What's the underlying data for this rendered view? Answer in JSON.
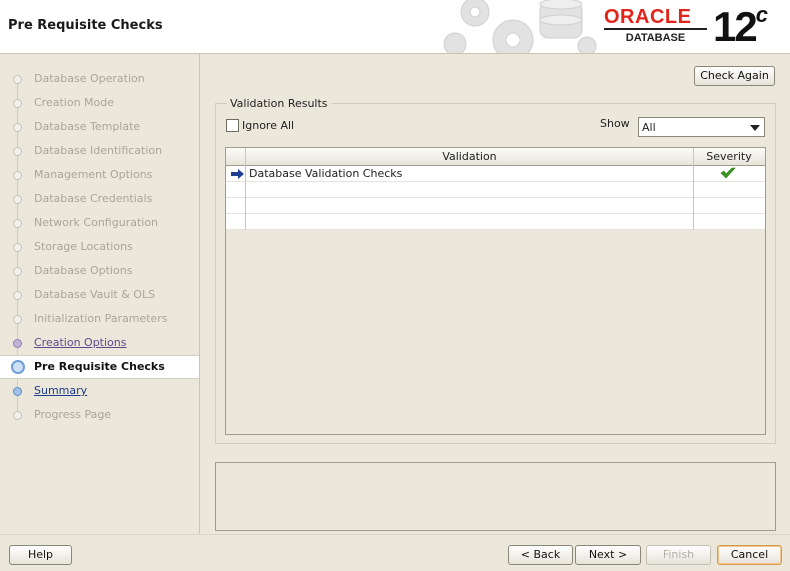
{
  "window": {
    "title": "Pre Requisite Checks"
  },
  "brand": {
    "oracle": "ORACLE",
    "database": "DATABASE",
    "version": "12",
    "version_suffix": "c"
  },
  "sidebar": {
    "steps": [
      {
        "label": "Database Operation",
        "state": "disabled"
      },
      {
        "label": "Creation Mode",
        "state": "disabled"
      },
      {
        "label": "Database Template",
        "state": "disabled"
      },
      {
        "label": "Database Identification",
        "state": "disabled"
      },
      {
        "label": "Management Options",
        "state": "disabled"
      },
      {
        "label": "Database Credentials",
        "state": "disabled"
      },
      {
        "label": "Network Configuration",
        "state": "disabled"
      },
      {
        "label": "Storage Locations",
        "state": "disabled"
      },
      {
        "label": "Database Options",
        "state": "disabled"
      },
      {
        "label": "Database Vault & OLS",
        "state": "disabled"
      },
      {
        "label": "Initialization Parameters",
        "state": "disabled"
      },
      {
        "label": "Creation Options",
        "state": "done"
      },
      {
        "label": "Pre Requisite Checks",
        "state": "current"
      },
      {
        "label": "Summary",
        "state": "link"
      },
      {
        "label": "Progress Page",
        "state": "disabled"
      }
    ]
  },
  "main": {
    "check_again_label": "Check Again",
    "group_title": "Validation Results",
    "ignore_all_label": "Ignore All",
    "ignore_all_checked": false,
    "show_label": "Show",
    "show_value": "All",
    "table": {
      "columns": [
        "Validation",
        "Severity"
      ],
      "rows": [
        {
          "validation": "Database Validation Checks",
          "severity_icon": "check-icon",
          "status": "passed"
        }
      ]
    }
  },
  "footer": {
    "help": "Help",
    "back": "< Back",
    "next": "Next >",
    "finish": "Finish",
    "cancel": "Cancel"
  },
  "colors": {
    "oracle_red": "#e1251b",
    "background": "#ebe7da",
    "check_green": "#3a9a1f",
    "arrow_blue": "#1f3f95"
  }
}
